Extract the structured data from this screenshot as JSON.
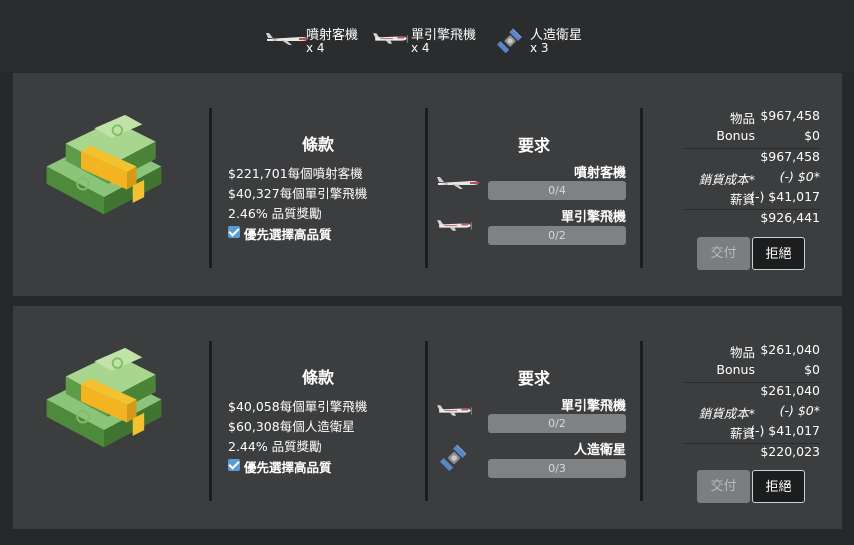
{
  "summary": [
    {
      "icon": "jet-airliner-icon",
      "name": "噴射客機",
      "count": "x 4"
    },
    {
      "icon": "prop-plane-icon",
      "name": "單引擎飛機",
      "count": "x 4"
    },
    {
      "icon": "satellite-icon",
      "name": "人造衛星",
      "count": "x 3"
    }
  ],
  "contracts": [
    {
      "terms_title": "條款",
      "terms": [
        "$221,701每個噴射客機",
        "$40,327每個單引擎飛機",
        "2.46% 品質獎勵"
      ],
      "prefer_quality": "優先選擇高品質",
      "req_title": "要求",
      "requirements": [
        {
          "icon": "jet-airliner-icon",
          "name": "噴射客機",
          "progress": "0/4",
          "fraction": 0
        },
        {
          "icon": "prop-plane-icon",
          "name": "單引擎飛機",
          "progress": "0/2",
          "fraction": 0
        }
      ],
      "finance": {
        "goods_label": "物品",
        "goods": "$967,458",
        "bonus_label": "Bonus",
        "bonus": "$0",
        "subtotal": "$967,458",
        "cogs_label": "銷貨成本*",
        "cogs": "(-) $0*",
        "wages_label": "薪資",
        "wages": "(-) $41,017",
        "total": "$926,441"
      },
      "deliver_label": "交付",
      "reject_label": "拒絕"
    },
    {
      "terms_title": "條款",
      "terms": [
        "$40,058每個單引擎飛機",
        "$60,308每個人造衛星",
        "2.44% 品質獎勵"
      ],
      "prefer_quality": "優先選擇高品質",
      "req_title": "要求",
      "requirements": [
        {
          "icon": "prop-plane-icon",
          "name": "單引擎飛機",
          "progress": "0/2",
          "fraction": 0
        },
        {
          "icon": "satellite-icon",
          "name": "人造衛星",
          "progress": "0/3",
          "fraction": 0
        }
      ],
      "finance": {
        "goods_label": "物品",
        "goods": "$261,040",
        "bonus_label": "Bonus",
        "bonus": "$0",
        "subtotal": "$261,040",
        "cogs_label": "銷貨成本*",
        "cogs": "(-) $0*",
        "wages_label": "薪資",
        "wages": "(-) $41,017",
        "total": "$220,023"
      },
      "deliver_label": "交付",
      "reject_label": "拒絕"
    }
  ],
  "colors": {
    "accent": "#5b9bd5",
    "panel": "#3c3d3e",
    "background": "#262829"
  }
}
